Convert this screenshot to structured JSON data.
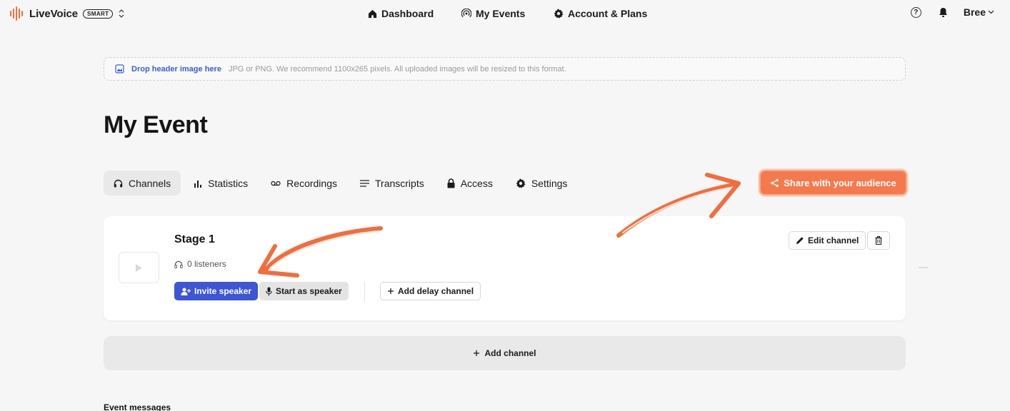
{
  "app": {
    "name": "LiveVoice",
    "badge": "SMART"
  },
  "nav": {
    "dashboard": "Dashboard",
    "my_events": "My Events",
    "account": "Account & Plans"
  },
  "user": {
    "help_glyph": "?",
    "name": "Bree"
  },
  "header_image": {
    "link": "Drop header image here",
    "hint": "JPG or PNG. We recommend 1100x265 pixels. All uploaded images will be resized to this format."
  },
  "page": {
    "title": "My Event"
  },
  "tabs": [
    {
      "label": "Channels",
      "icon": "headphones-icon",
      "active": true
    },
    {
      "label": "Statistics",
      "icon": "bar-chart-icon",
      "active": false
    },
    {
      "label": "Recordings",
      "icon": "voicemail-icon",
      "active": false
    },
    {
      "label": "Transcripts",
      "icon": "lines-icon",
      "active": false
    },
    {
      "label": "Access",
      "icon": "lock-icon",
      "active": false
    },
    {
      "label": "Settings",
      "icon": "gear-icon",
      "active": false
    }
  ],
  "share": {
    "label": "Share with your audience"
  },
  "channel": {
    "name": "Stage 1",
    "listeners": "0 listeners",
    "invite_label": "Invite speaker",
    "start_label": "Start as speaker",
    "delay_label": "Add delay channel",
    "edit_label": "Edit channel"
  },
  "add_channel": {
    "label": "Add channel"
  },
  "sections": {
    "event_messages": "Event messages"
  },
  "colors": {
    "brand_orange": "#f47a4e",
    "primary_blue": "#3d55d6",
    "link_blue": "#3b5bd9",
    "annotation_arrow": "#f26d3d"
  }
}
